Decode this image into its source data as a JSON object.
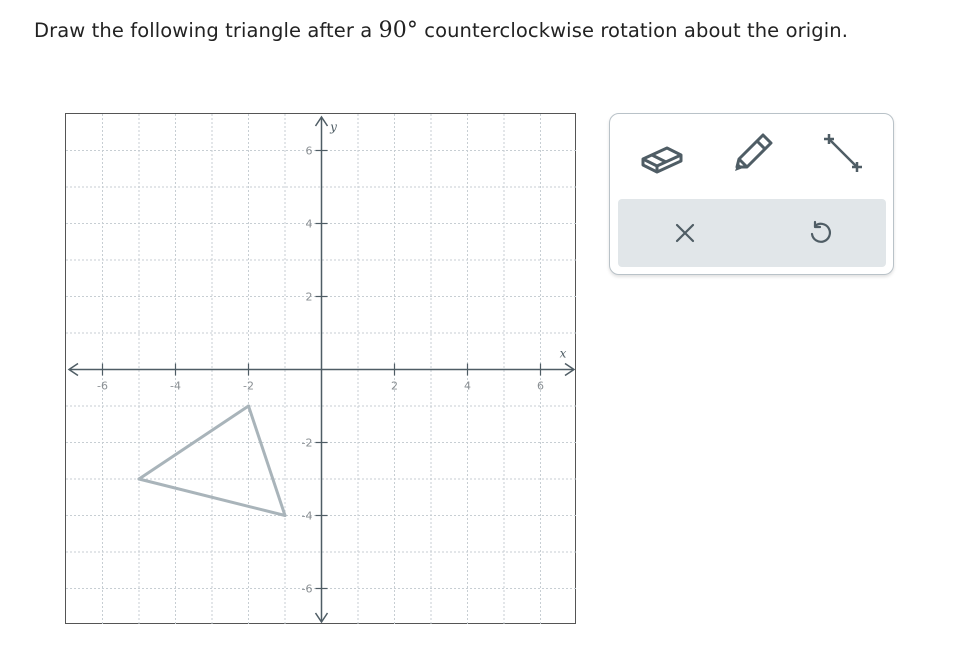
{
  "prompt": {
    "before": "Draw the following triangle after a ",
    "math": "90°",
    "after": " counterclockwise rotation about the origin."
  },
  "chart_data": {
    "type": "scatter",
    "title": "",
    "xlabel": "x",
    "ylabel": "y",
    "xlim": [
      -7,
      7
    ],
    "ylim": [
      -7,
      7
    ],
    "grid": true,
    "grid_minor_step": 1,
    "x_ticks": [
      -6,
      -4,
      -2,
      2,
      4,
      6
    ],
    "y_ticks": [
      -6,
      -4,
      -2,
      2,
      4,
      6
    ],
    "series": [
      {
        "x": [
          -2,
          -5,
          -1
        ],
        "y": [
          -1,
          -3,
          -4
        ]
      }
    ],
    "shape": "triangle",
    "colors": {
      "triangle": "#a9b4ba",
      "axis": "#4f5d65",
      "grid": "#c7ced3",
      "tick_label": "#8a8f93"
    }
  },
  "tools": {
    "eraser": "eraser-icon",
    "pencil": "pencil-icon",
    "segment": "line-segment-icon",
    "clear": "close-icon",
    "undo": "undo-icon"
  }
}
